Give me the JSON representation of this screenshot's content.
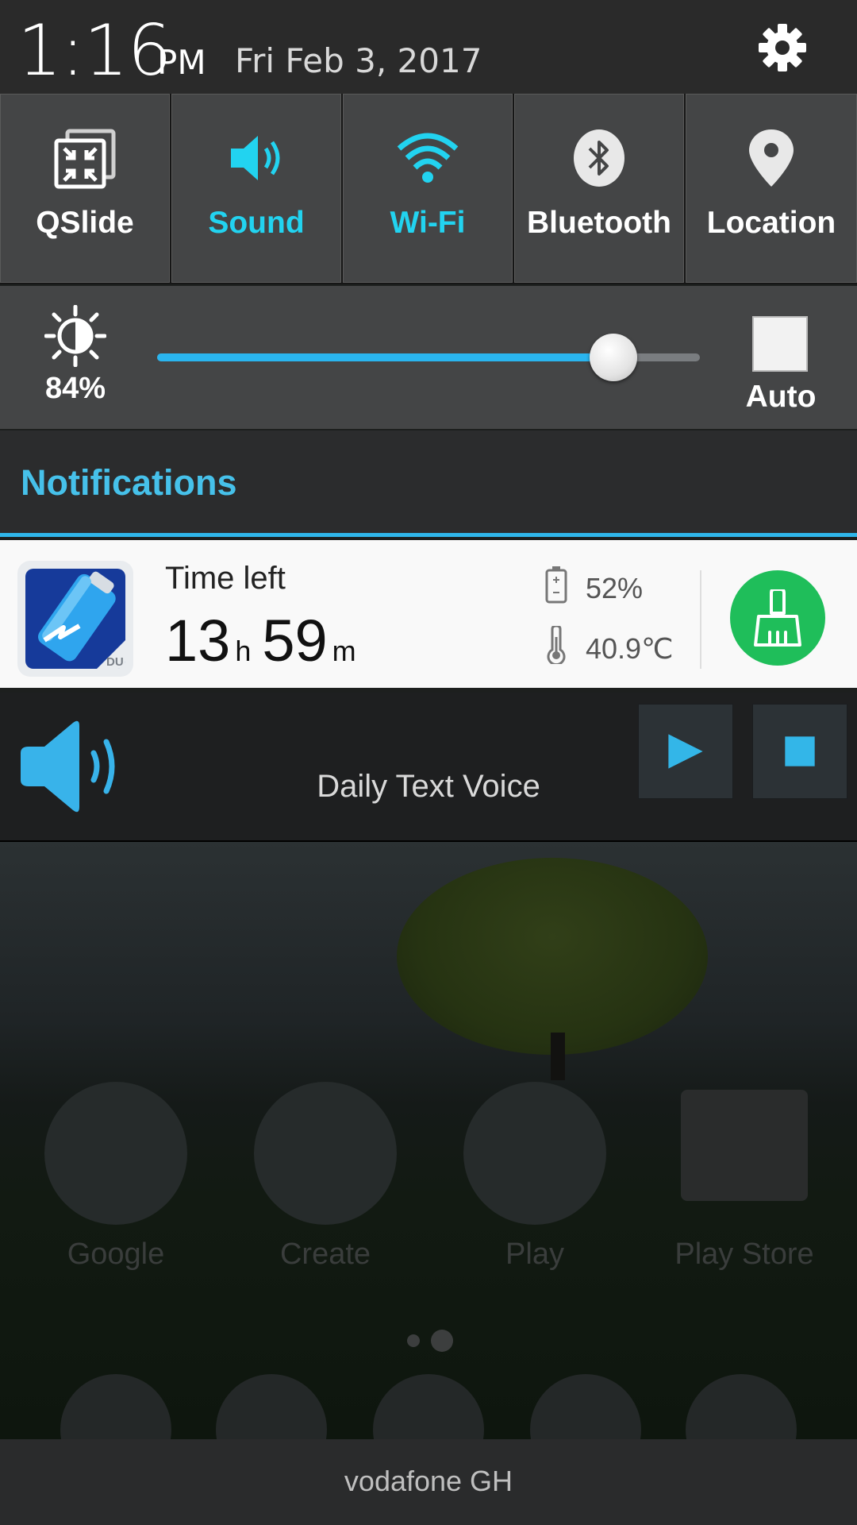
{
  "header": {
    "time": "1:16",
    "ampm": "PM",
    "date": "Fri Feb 3, 2017"
  },
  "quick_settings": {
    "tiles": [
      {
        "label": "QSlide",
        "icon": "qslide-icon",
        "active": false
      },
      {
        "label": "Sound",
        "icon": "sound-icon",
        "active": true
      },
      {
        "label": "Wi-Fi",
        "icon": "wifi-icon",
        "active": true
      },
      {
        "label": "Bluetooth",
        "icon": "bluetooth-icon",
        "active": false
      },
      {
        "label": "Location",
        "icon": "location-icon",
        "active": false
      }
    ],
    "active_color": "#22d3f0"
  },
  "brightness": {
    "value_label": "84%",
    "level": 0.84,
    "auto_label": "Auto",
    "auto_checked": false,
    "accent": "#2ab5ef"
  },
  "notifications": {
    "title": "Notifications",
    "battery": {
      "time_left_label": "Time left",
      "hours": "13",
      "hours_unit": "h",
      "minutes": "59",
      "minutes_unit": "m",
      "battery_percent": "52%",
      "temperature": "40.9℃",
      "app_icon": "du-battery-icon",
      "action_icon": "broom-icon",
      "action_color": "#1fbe5a"
    },
    "media": {
      "title": "Daily Text Voice",
      "play_icon": "play-icon",
      "stop_icon": "stop-icon"
    }
  },
  "home_screen": {
    "apps": [
      {
        "label": "Google"
      },
      {
        "label": "Create"
      },
      {
        "label": "Play"
      },
      {
        "label": "Play Store"
      }
    ]
  },
  "carrier": {
    "name": "vodafone GH"
  }
}
